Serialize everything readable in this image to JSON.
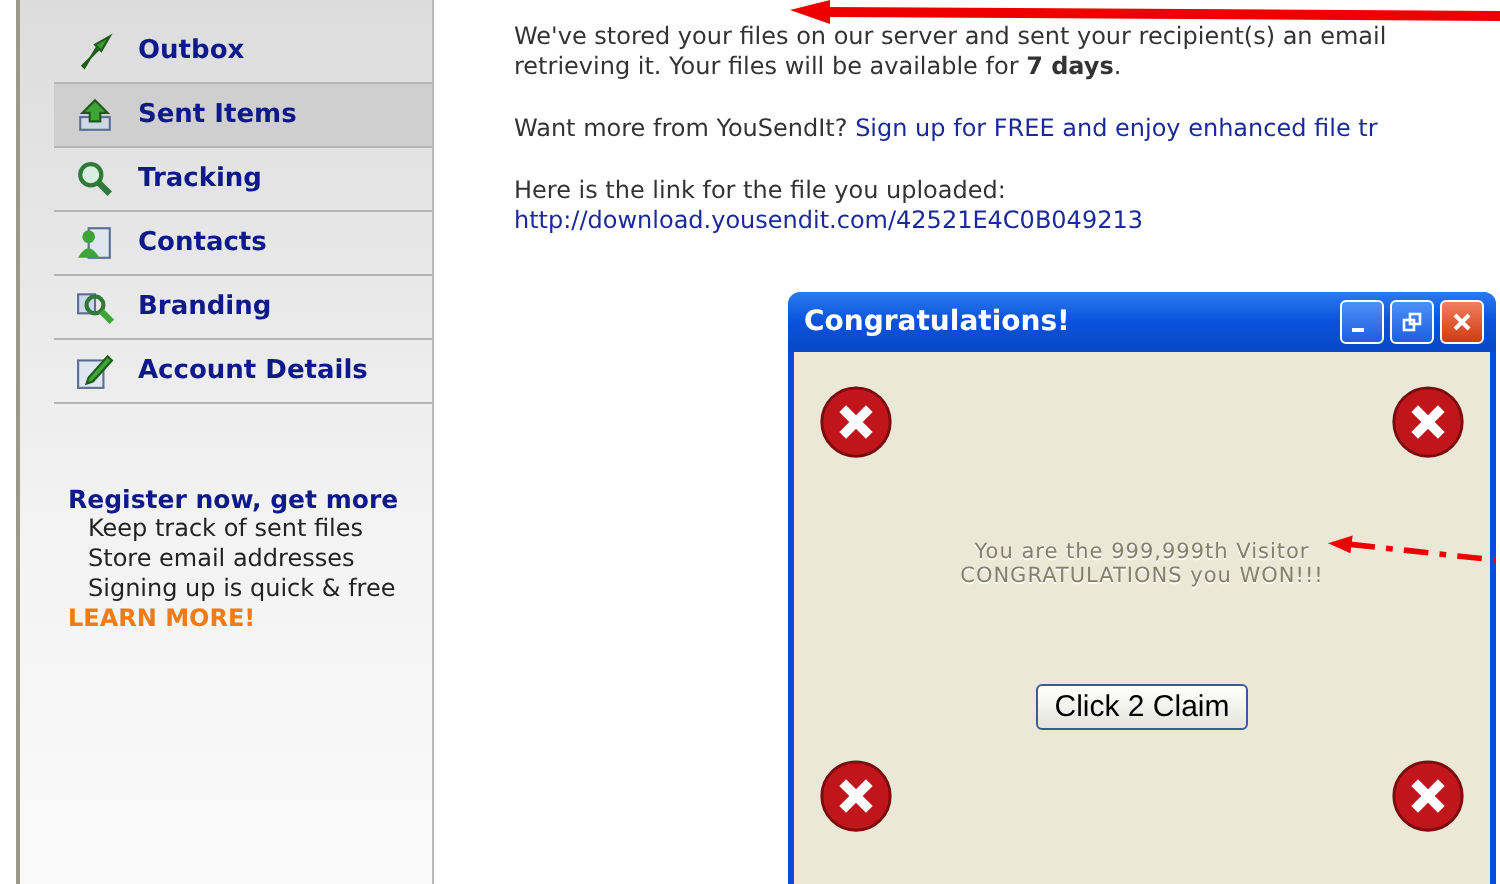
{
  "sidebar": {
    "items": [
      {
        "label": "Outbox",
        "selected": false
      },
      {
        "label": "Sent Items",
        "selected": true
      },
      {
        "label": "Tracking",
        "selected": false
      },
      {
        "label": "Contacts",
        "selected": false
      },
      {
        "label": "Branding",
        "selected": false
      },
      {
        "label": "Account Details",
        "selected": false
      }
    ],
    "promo": {
      "title": "Register now, get more",
      "lines": [
        "Keep track of sent files",
        "Store email addresses",
        "Signing up is quick & free"
      ],
      "link": "LEARN MORE!"
    }
  },
  "content": {
    "stored": "We've stored your files on our server and sent your recipient(s) an email",
    "retrieving": "retrieving it. Your files will be available for **7 days**.",
    "want_more": "Want more from YouSendIt?",
    "signup_link": "Sign up for FREE and enjoy enhanced file tr",
    "link_intro": "Here is the link for the file you uploaded:",
    "file_link": "http://download.yousendit.com/42521E4C0B049213"
  },
  "popup": {
    "title": "Congratulations!",
    "message": [
      "You are the 999,999th Visitor",
      "CONGRATULATIONS you WON!!!"
    ],
    "button": "Click 2 Claim"
  }
}
